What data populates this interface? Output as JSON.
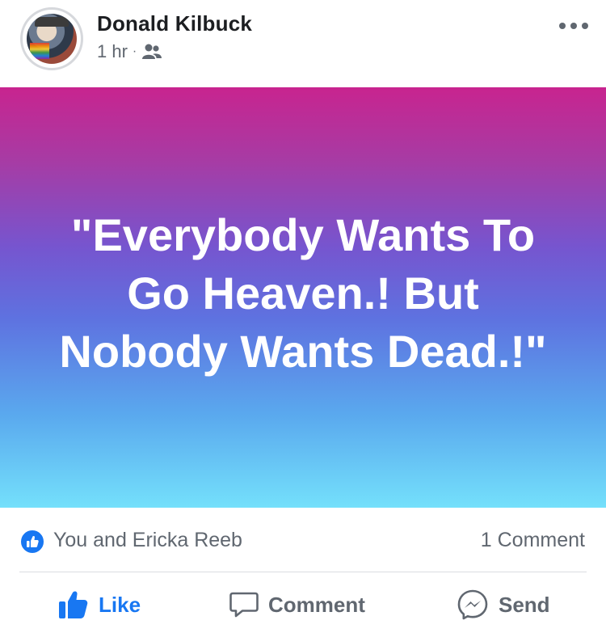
{
  "post": {
    "author": "Donald Kilbuck",
    "time": "1 hr",
    "separator": "·",
    "audience_icon": "friends-icon",
    "more_icon": "more-horizontal-icon",
    "text": "\"Everybody Wants To Go Heaven.! But Nobody Wants Dead.!\"",
    "background_colors": [
      "#c8248f",
      "#7655cf",
      "#74e0fb"
    ]
  },
  "reactions": {
    "icon": "like-icon",
    "summary": "You and Ericka Reeb",
    "comments": "1 Comment"
  },
  "actions": {
    "like": "Like",
    "comment": "Comment",
    "send": "Send"
  },
  "colors": {
    "accent": "#1877f2",
    "muted": "#606770"
  }
}
